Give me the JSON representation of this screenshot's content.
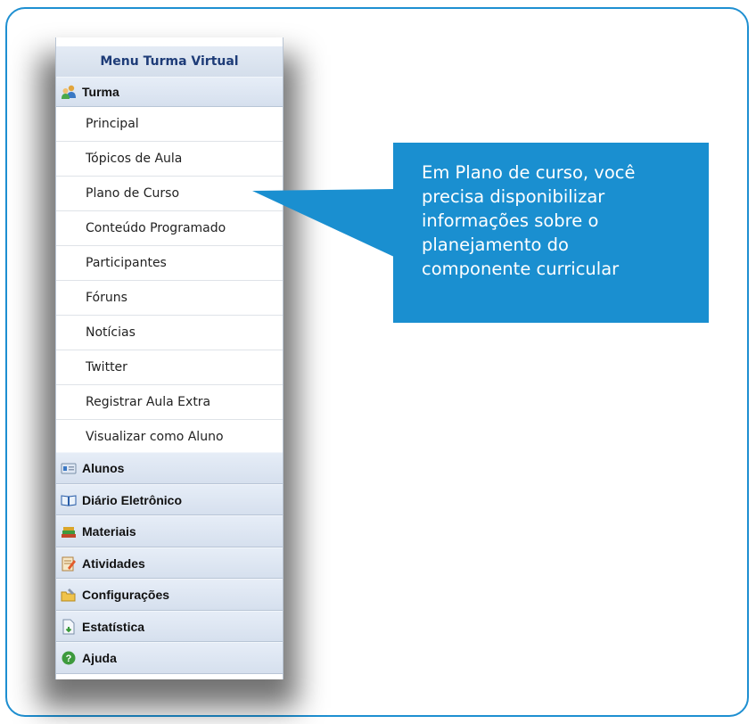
{
  "menu": {
    "title": "Menu Turma Virtual",
    "turma": {
      "label": "Turma",
      "icon": "users-icon",
      "items": [
        "Principal",
        "Tópicos de Aula",
        "Plano de Curso",
        "Conteúdo Programado",
        "Participantes",
        "Fóruns",
        "Notícias",
        "Twitter",
        "Registrar Aula Extra",
        "Visualizar como Aluno"
      ]
    },
    "sections": [
      {
        "label": "Alunos",
        "icon": "id-card-icon"
      },
      {
        "label": "Diário Eletrônico",
        "icon": "open-book-icon"
      },
      {
        "label": "Materiais",
        "icon": "books-stack-icon"
      },
      {
        "label": "Atividades",
        "icon": "notepad-pencil-icon"
      },
      {
        "label": "Configurações",
        "icon": "folder-wrench-icon"
      },
      {
        "label": "Estatística",
        "icon": "document-download-icon"
      },
      {
        "label": "Ajuda",
        "icon": "help-icon"
      }
    ]
  },
  "callout": {
    "text": "Em Plano de curso, você\nprecisa disponibilizar\ninformações sobre o\nplanejamento do\ncomponente curricular",
    "color": "#1a8fd0"
  }
}
